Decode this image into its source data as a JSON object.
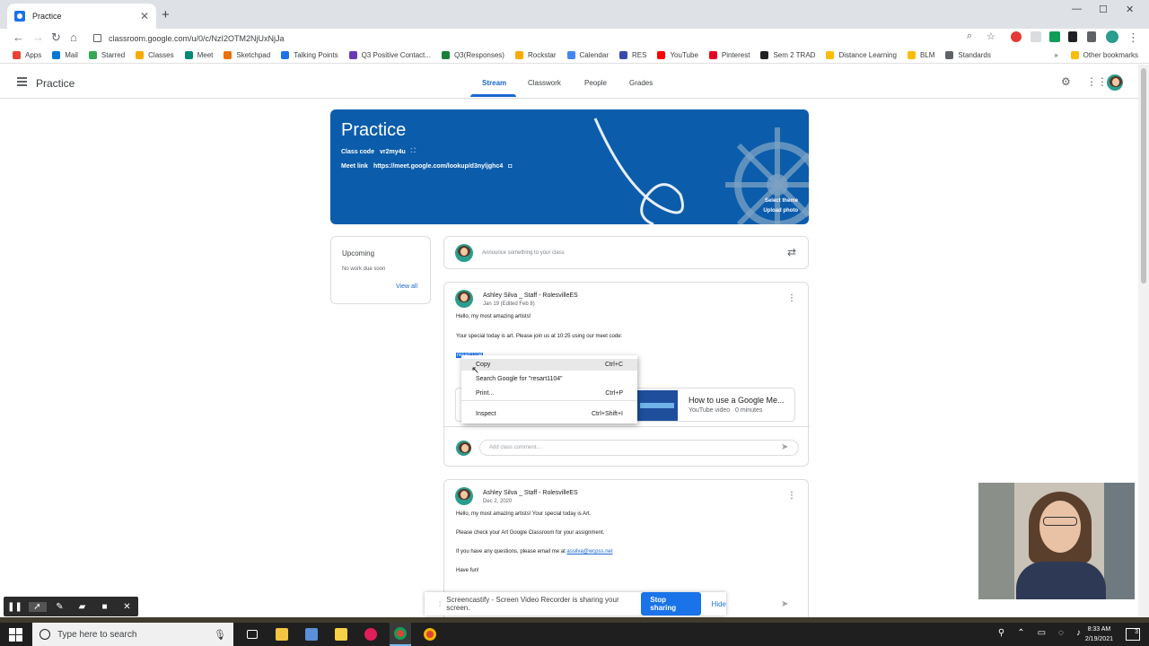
{
  "browser": {
    "tab_title": "Practice",
    "url": "classroom.google.com/u/0/c/NzI2OTM2NjUxNjJa",
    "bookmarks": [
      {
        "label": "Apps",
        "color": "#ea4335"
      },
      {
        "label": "Mail",
        "color": "#0078d4"
      },
      {
        "label": "Starred",
        "color": "#34a853"
      },
      {
        "label": "Classes",
        "color": "#f9ab00"
      },
      {
        "label": "Meet",
        "color": "#00897b"
      },
      {
        "label": "Sketchpad",
        "color": "#e8710a"
      },
      {
        "label": "Talking Points",
        "color": "#1a73e8"
      },
      {
        "label": "Q3 Positive Contact...",
        "color": "#673ab7"
      },
      {
        "label": "Q3(Responses)",
        "color": "#188038"
      },
      {
        "label": "Rockstar",
        "color": "#f9ab00"
      },
      {
        "label": "Calendar",
        "color": "#4285f4"
      },
      {
        "label": "RES",
        "color": "#3949ab"
      },
      {
        "label": "YouTube",
        "color": "#ff0000"
      },
      {
        "label": "Pinterest",
        "color": "#e60023"
      },
      {
        "label": "Sem 2 TRAD",
        "color": "#202124"
      },
      {
        "label": "Distance Learning",
        "color": "#fbbc04"
      },
      {
        "label": "BLM",
        "color": "#fbbc04"
      },
      {
        "label": "Standards",
        "color": "#5f6368"
      }
    ],
    "other_bookmarks": "Other bookmarks"
  },
  "classroom": {
    "title": "Practice",
    "tabs": [
      "Stream",
      "Classwork",
      "People",
      "Grades"
    ],
    "banner": {
      "title": "Practice",
      "class_code_label": "Class code",
      "class_code": "vr2my4u",
      "meet_link_label": "Meet link",
      "meet_link": "https://meet.google.com/lookup/d3nyljghc4",
      "select_theme": "Select theme",
      "upload_photo": "Upload photo"
    },
    "upcoming": {
      "title": "Upcoming",
      "empty": "No work due soon",
      "view_all": "View all"
    },
    "announce_placeholder": "Announce something to your class",
    "posts": [
      {
        "author": "Ashley Silva _ Staff - RolesvilleES",
        "date": "Jan 19 (Edited Feb 8)",
        "line1": "Hello, my most amazing artists!",
        "line2": "Your special today is art.  Please join us at 10:25 using our meet code:",
        "selected": "resart1104",
        "attachment_title": "How to use a Google Me...",
        "attachment_sub": "YouTube video   0 minutes",
        "comment_placeholder": "Add class comment..."
      },
      {
        "author": "Ashley Silva _ Staff - RolesvilleES",
        "date": "Dec 2, 2020",
        "line1": "Hello, my most amazing artists!  Your special today is Art.",
        "line2": "Please check your Art Google Classroom for your assignment.",
        "line3": "If you have any questions, please email me at",
        "email": "assilva@wcpss.net",
        "line4": "Have fun!"
      }
    ]
  },
  "context_menu": {
    "items": [
      {
        "label": "Copy",
        "shortcut": "Ctrl+C"
      },
      {
        "label": "Search Google for \"resart1104\"",
        "shortcut": ""
      },
      {
        "label": "Print...",
        "shortcut": "Ctrl+P"
      },
      {
        "label": "Inspect",
        "shortcut": "Ctrl+Shift+I"
      }
    ]
  },
  "screencastify": {
    "message": "Screencastify - Screen Video Recorder is sharing your screen.",
    "stop": "Stop sharing",
    "hide": "Hide"
  },
  "taskbar": {
    "search_placeholder": "Type here to search",
    "time": "8:33 AM",
    "date": "2/19/2021",
    "notification_count": "3"
  }
}
